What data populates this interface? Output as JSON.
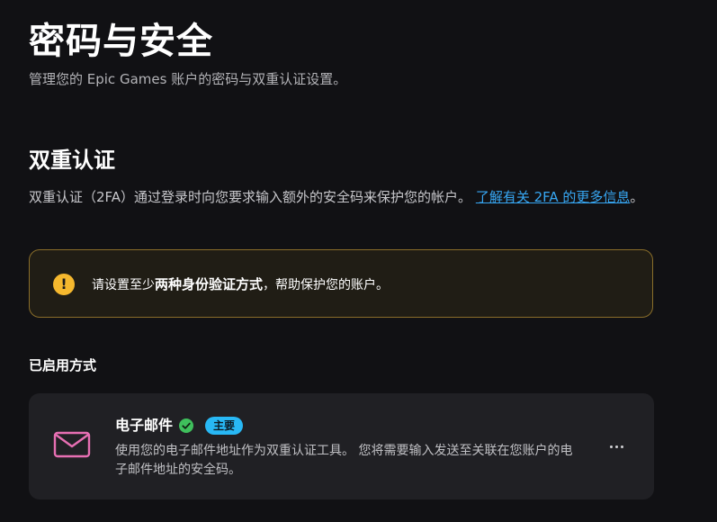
{
  "header": {
    "title": "密码与安全",
    "subtitle": "管理您的 Epic Games 账户的密码与双重认证设置。"
  },
  "two_factor": {
    "title": "双重认证",
    "description": "双重认证（2FA）通过登录时向您要求输入额外的安全码来保护您的帐户。 ",
    "learn_more_link": "了解有关 2FA 的更多信息",
    "description_end": "。"
  },
  "warning": {
    "icon": "exclamation-icon",
    "color": "#f5b82e",
    "text_prefix": "请设置至少",
    "text_strong": "两种身份验证方式",
    "text_suffix": "，帮助保护您的账户。"
  },
  "enabled_methods": {
    "title": "已启用方式",
    "items": [
      {
        "icon": "mail-icon",
        "name": "电子邮件",
        "verified_icon": "check-circle-icon",
        "badge": "主要",
        "description": "使用您的电子邮件地址作为双重认证工具。 您将需要输入发送至关联在您账户的电子邮件地址的安全码。",
        "more_icon": "more-horizontal-icon"
      }
    ]
  },
  "colors": {
    "background": "#111114",
    "card": "#202024",
    "link": "#37a7f3",
    "badge": "#28b8f5",
    "warning_border": "#8a6e2a",
    "check": "#3fbf5c",
    "mail_icon": "#e76fb3"
  }
}
